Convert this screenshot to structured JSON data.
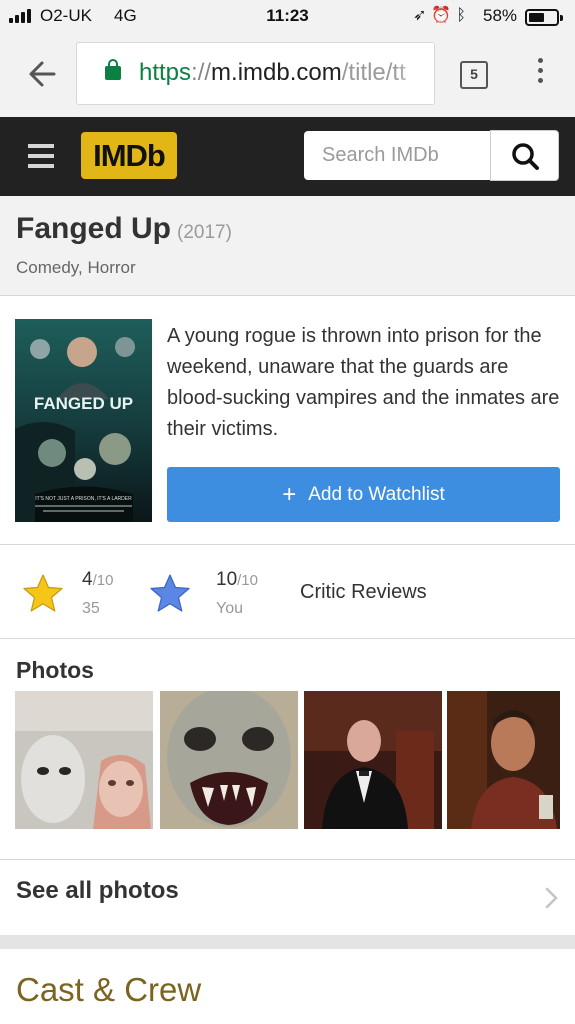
{
  "status_bar": {
    "carrier": "O2-UK",
    "network": "4G",
    "time": "11:23",
    "icons": [
      "location-arrow",
      "alarm",
      "bluetooth"
    ],
    "battery": "58%",
    "battery_level": 0.58
  },
  "browser": {
    "url_scheme": "https",
    "url_sep": "://",
    "url_host": "m.imdb.com",
    "url_path": "/title/tt",
    "tab_count": "5"
  },
  "header": {
    "logo": "IMDb",
    "search_placeholder": "Search IMDb",
    "colors": {
      "bar": "#222222",
      "logo": "#e2b616"
    }
  },
  "title": {
    "name": "Fanged Up",
    "year": "(2017)",
    "genres": "Comedy, Horror"
  },
  "overview": {
    "poster_title": "FANGED UP",
    "poster_tagline": "IT'S NOT JUST A PRISON, IT'S A LARDER",
    "plot": "A young rogue is thrown into prison for the weekend, unaware that the guards are blood-sucking vampires and the inmates are their victims.",
    "watchlist_label": "Add to Watchlist",
    "watchlist_color": "#3d8ee0"
  },
  "ratings": {
    "user_rating": "4",
    "user_outof": "/10",
    "user_count": "35",
    "your_rating": "10",
    "your_outof": "/10",
    "your_label": "You",
    "critic_label": "Critic Reviews",
    "colors": {
      "imdb_star": "#f5c518",
      "your_star": "#5b86e5"
    }
  },
  "photos": {
    "heading": "Photos",
    "see_all": "See all photos"
  },
  "cast": {
    "heading": "Cast & Crew"
  }
}
